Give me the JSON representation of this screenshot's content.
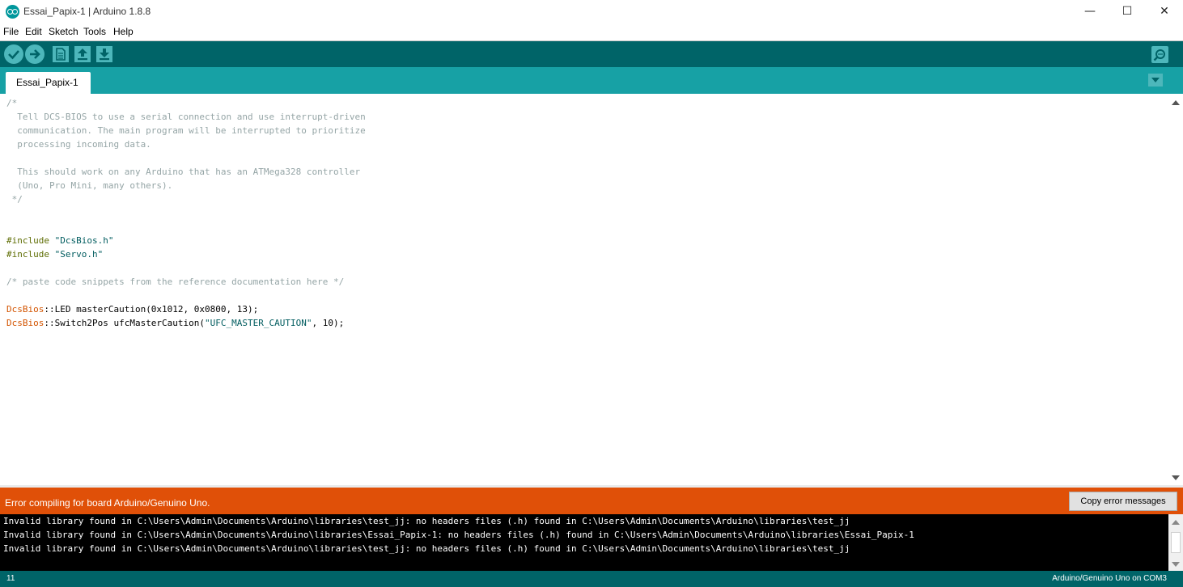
{
  "window": {
    "title": "Essai_Papix-1 | Arduino 1.8.8",
    "minimize_glyph": "—",
    "maximize_glyph": "☐",
    "close_glyph": "✕"
  },
  "menu": [
    "File",
    "Edit",
    "Sketch",
    "Tools",
    "Help"
  ],
  "toolbar": {
    "buttons": [
      "verify-icon",
      "upload-icon",
      "new-icon",
      "open-icon",
      "save-icon"
    ],
    "right_button": "serial-monitor-icon"
  },
  "tabs": [
    {
      "label": "Essai_Papix-1"
    }
  ],
  "editor": {
    "lines": [
      {
        "type": "comment",
        "text": "/*"
      },
      {
        "type": "comment",
        "text": "  Tell DCS-BIOS to use a serial connection and use interrupt-driven"
      },
      {
        "type": "comment",
        "text": "  communication. The main program will be interrupted to prioritize"
      },
      {
        "type": "comment",
        "text": "  processing incoming data."
      },
      {
        "type": "comment",
        "text": " "
      },
      {
        "type": "comment",
        "text": "  This should work on any Arduino that has an ATMega328 controller"
      },
      {
        "type": "comment",
        "text": "  (Uno, Pro Mini, many others)."
      },
      {
        "type": "comment",
        "text": " */"
      },
      {
        "type": "blank",
        "text": ""
      },
      {
        "type": "blank",
        "text": ""
      },
      {
        "type": "include",
        "directive": "#include",
        "rest": " ",
        "string": "\"DcsBios.h\""
      },
      {
        "type": "include",
        "directive": "#include",
        "rest": " ",
        "string": "\"Servo.h\""
      },
      {
        "type": "blank",
        "text": ""
      },
      {
        "type": "comment",
        "text": "/* paste code snippets from the reference documentation here */"
      },
      {
        "type": "blank",
        "text": ""
      },
      {
        "type": "decl",
        "cls": "DcsBios",
        "rest": "::LED masterCaution(0x1012, 0x0800, 13);"
      },
      {
        "type": "decl2",
        "cls": "DcsBios",
        "rest": "::Switch2Pos ufcMasterCaution(",
        "string": "\"UFC_MASTER_CAUTION\"",
        "tail": ", 10);"
      }
    ]
  },
  "status": {
    "message": "Error compiling for board Arduino/Genuino Uno.",
    "copy_button": "Copy error messages"
  },
  "console": {
    "lines": [
      "Invalid library found in C:\\Users\\Admin\\Documents\\Arduino\\libraries\\test_jj: no headers files (.h) found in C:\\Users\\Admin\\Documents\\Arduino\\libraries\\test_jj",
      "Invalid library found in C:\\Users\\Admin\\Documents\\Arduino\\libraries\\Essai_Papix-1: no headers files (.h) found in C:\\Users\\Admin\\Documents\\Arduino\\libraries\\Essai_Papix-1",
      "Invalid library found in C:\\Users\\Admin\\Documents\\Arduino\\libraries\\test_jj: no headers files (.h) found in C:\\Users\\Admin\\Documents\\Arduino\\libraries\\test_jj"
    ]
  },
  "footer": {
    "line_number": "11",
    "board": "Arduino/Genuino Uno on COM3"
  },
  "colors": {
    "toolbar": "#006468",
    "tabbar": "#17a1a5",
    "error_bar": "#e05008",
    "comment": "#95a5a6",
    "directive": "#5e6d03",
    "string": "#005c5f",
    "class": "#d35400"
  }
}
